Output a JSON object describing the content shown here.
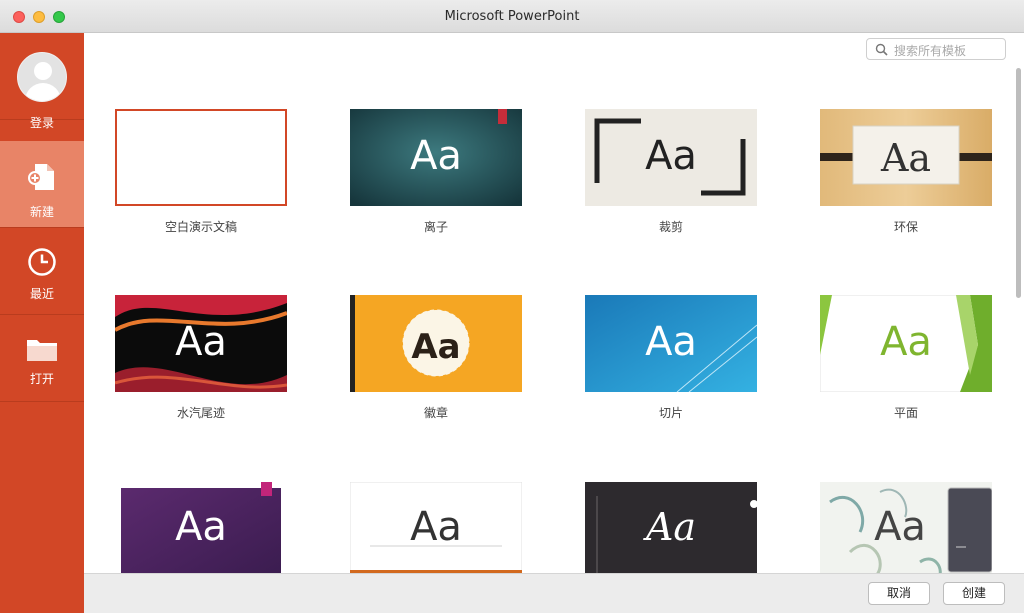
{
  "window": {
    "title": "Microsoft PowerPoint"
  },
  "sidebar": {
    "items": [
      {
        "label": "登录",
        "icon": "avatar"
      },
      {
        "label": "新建",
        "icon": "new-document-icon",
        "active": true
      },
      {
        "label": "最近",
        "icon": "clock-icon"
      },
      {
        "label": "打开",
        "icon": "folder-icon"
      }
    ]
  },
  "search": {
    "placeholder": "搜索所有模板"
  },
  "templates": [
    {
      "name": "空白演示文稿",
      "sample": ""
    },
    {
      "name": "离子",
      "sample": "Aa"
    },
    {
      "name": "裁剪",
      "sample": "Aa"
    },
    {
      "name": "环保",
      "sample": "Aa"
    },
    {
      "name": "水汽尾迹",
      "sample": "Aa"
    },
    {
      "name": "徽章",
      "sample": "Aa"
    },
    {
      "name": "切片",
      "sample": "Aa"
    },
    {
      "name": "平面",
      "sample": "Aa"
    },
    {
      "name": "",
      "sample": "Aa"
    },
    {
      "name": "",
      "sample": "Aa"
    },
    {
      "name": "",
      "sample": "Aa"
    },
    {
      "name": "",
      "sample": "Aa"
    }
  ],
  "buttons": {
    "cancel": "取消",
    "create": "创建"
  },
  "colors": {
    "sidebar": "#d24726",
    "sidebar_active": "#e88467"
  }
}
